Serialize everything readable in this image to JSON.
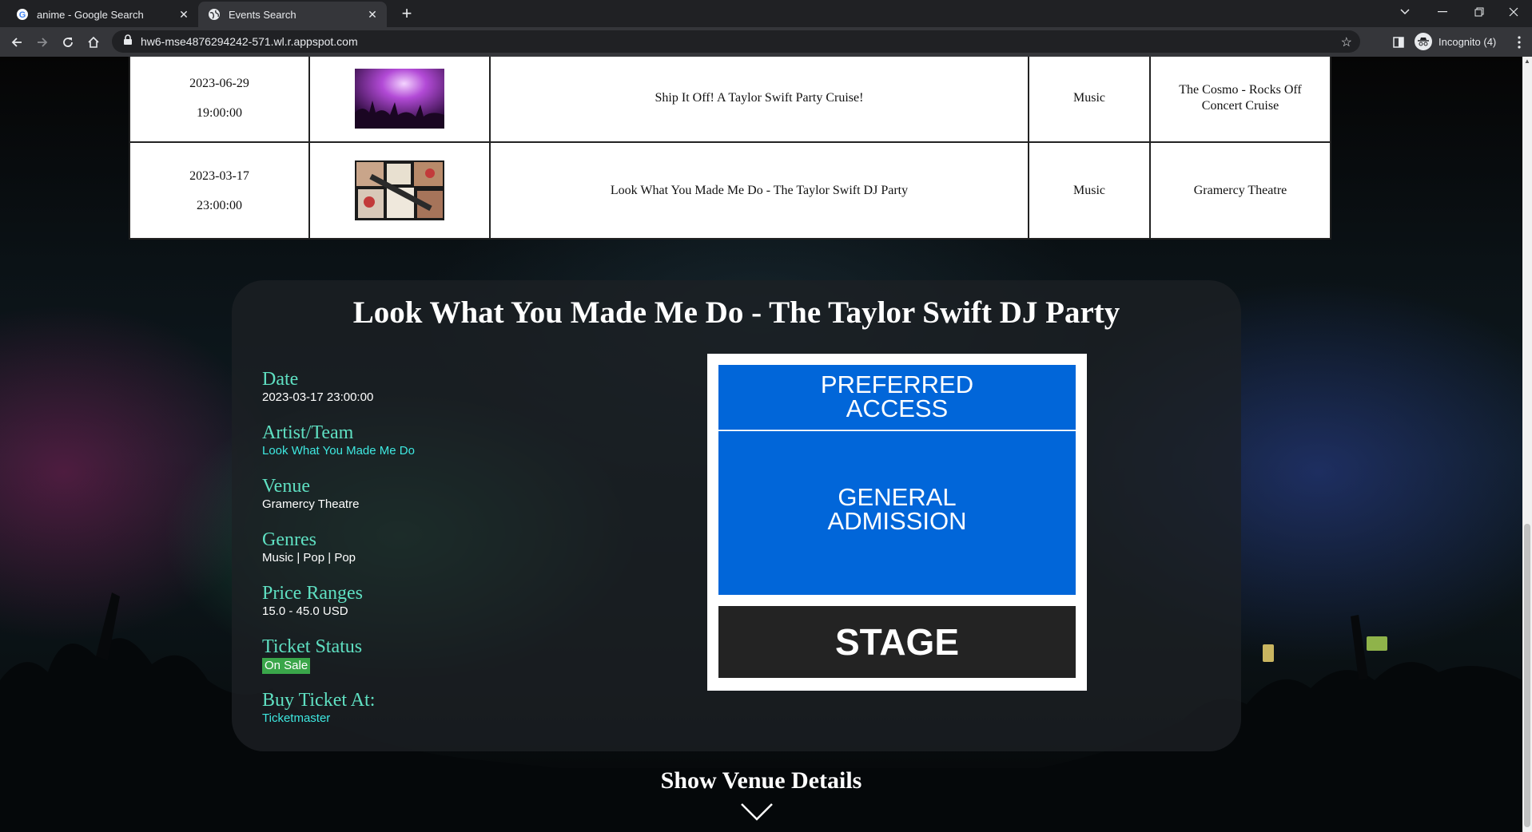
{
  "browser": {
    "tabs": [
      {
        "title": "anime - Google Search",
        "active": false
      },
      {
        "title": "Events Search",
        "active": true
      }
    ],
    "url": "hw6-mse4876294242-571.wl.r.appspot.com",
    "profile_label": "Incognito (4)"
  },
  "results": {
    "rows": [
      {
        "date": "2023-06-29",
        "time": "19:00:00",
        "image": "concert-crowd-image",
        "event": "Ship It Off! A Taylor Swift Party Cruise!",
        "genre": "Music",
        "venue": "The Cosmo - Rocks Off Concert Cruise"
      },
      {
        "date": "2023-03-17",
        "time": "23:00:00",
        "image": "taylor-swift-collage-image",
        "event": "Look What You Made Me Do - The Taylor Swift DJ Party",
        "genre": "Music",
        "venue": "Gramercy Theatre"
      }
    ]
  },
  "detail": {
    "title": "Look What You Made Me Do - The Taylor Swift DJ Party",
    "fields": {
      "date_label": "Date",
      "date_value": "2023-03-17 23:00:00",
      "artist_label": "Artist/Team",
      "artist_value": "Look What You Made Me Do",
      "venue_label": "Venue",
      "venue_value": "Gramercy Theatre",
      "genres_label": "Genres",
      "genres_value": "Music | Pop | Pop",
      "price_label": "Price Ranges",
      "price_value": "15.0 - 45.0 USD",
      "status_label": "Ticket Status",
      "status_value": "On Sale",
      "buy_label": "Buy Ticket At:",
      "buy_value": "Ticketmaster"
    },
    "seatmap": {
      "section_1_line_1": "PREFERRED",
      "section_1_line_2": "ACCESS",
      "section_2_line_1": "GENERAL",
      "section_2_line_2": "ADMISSION",
      "stage": "STAGE"
    }
  },
  "venue_toggle_label": "Show Venue Details",
  "colors": {
    "label_accent": "#5fe0c2",
    "link": "#3ee8e0",
    "on_sale_badge": "#3aa64a",
    "seat_section": "#0166d9",
    "stage": "#232323"
  }
}
